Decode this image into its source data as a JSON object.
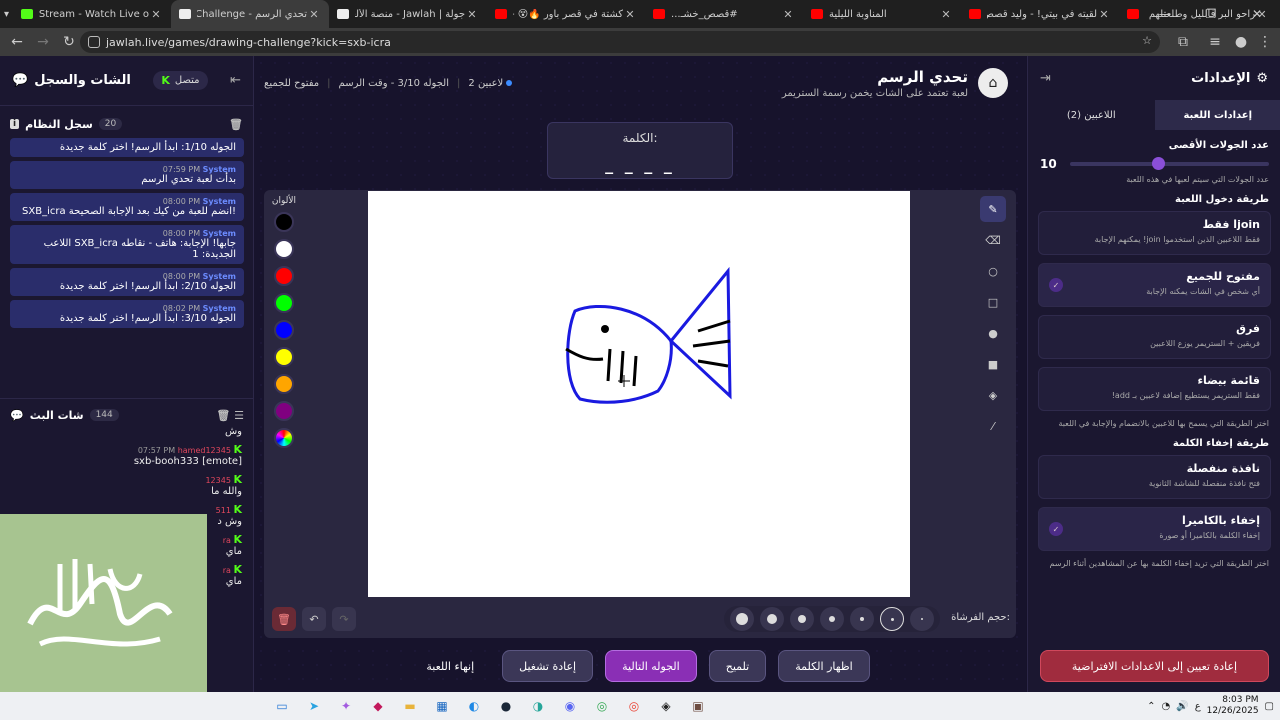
{
  "browser": {
    "tabs": [
      {
        "title": "SXB_icra Stream - Watch Live o",
        "color": "#53fc18",
        "active": false
      },
      {
        "title": "تحدي الرسم - Drawing Challenge",
        "color": "#eeeeee",
        "active": true
      },
      {
        "title": "جولة | Jawlah - منصة الألعاب الت",
        "color": "#eeeeee",
        "active": false
      },
      {
        "title": "كشتة في قصر باور 🔥😵 - Tube",
        "color": "#ff0000",
        "active": false
      },
      {
        "title": "#قصص_خشـ...",
        "color": "#ff0000",
        "active": false
      },
      {
        "title": "المناوبة الليلية",
        "color": "#ff0000",
        "active": false
      },
      {
        "title": "لقيته في بيتي! - وليد قصص - e",
        "color": "#ff0000",
        "active": false
      },
      {
        "title": "راحو البر فالليل وطلعتلهم ام دنوه",
        "color": "#ff0000",
        "active": false
      }
    ],
    "url": "jawlah.live/games/drawing-challenge?kick=sxb-icra"
  },
  "left": {
    "title": "الشات والسجل",
    "status": "متصل",
    "sys_title": "سجل النظام",
    "sys_count": "20",
    "sys_msgs": [
      {
        "author": "",
        "time": "",
        "text": "الجوله 1/10: ابدأ الرسم! اختر كلمة جديدة"
      },
      {
        "author": "System",
        "time": "07:59 PM",
        "text": "بدأت لعبة تحدي الرسم"
      },
      {
        "author": "System",
        "time": "08:00 PM",
        "text": "SXB_icra انضم للعبة من كيك بعد الإجابة الصحيحة!"
      },
      {
        "author": "System",
        "time": "08:00 PM",
        "text": "اللاعب SXB_icra جابها! الإجابة: هاتف - نقاطه الجديدة: 1"
      },
      {
        "author": "System",
        "time": "08:00 PM",
        "text": "الجوله 2/10: ابدأ الرسم! اختر كلمة جديدة"
      },
      {
        "author": "System",
        "time": "08:02 PM",
        "text": "الجوله 3/10: ابدأ الرسم! اختر كلمة جديدة"
      }
    ],
    "chat_title": "شات البث",
    "chat_count": "144",
    "chat_msgs": [
      {
        "user": "",
        "time": "",
        "text": "وش"
      },
      {
        "user": "hamed12345",
        "time": "07:57 PM",
        "text": "sxb-booh333 [emote]"
      },
      {
        "user": "12345",
        "time": "",
        "text": "والله ما"
      },
      {
        "user": "511",
        "time": "",
        "text": "وش د"
      },
      {
        "user": "ra",
        "time": "",
        "text": "ماي"
      },
      {
        "user": "ra",
        "time": "",
        "text": "ماي"
      }
    ]
  },
  "game": {
    "title": "تحدي الرسم",
    "subtitle": "لعبة تعتمد على الشات يخمن رسمة الستريمر",
    "players": "2 لاعبين",
    "round": "الجوله 3/10 - وقت الرسم",
    "mode": "مفتوح للجميع",
    "word_label": "الكلمة:",
    "word_blanks": "_ _ _ _",
    "colors_label": "الألوان",
    "colors": [
      "#000000",
      "#ffffff",
      "#ff0000",
      "#00ff00",
      "#0000ff",
      "#ffff00",
      "#ffa500",
      "#800080"
    ],
    "brush_label": "حجم الفرشاة:",
    "buttons": {
      "show_word": "اظهار الكلمة",
      "hint": "تلميح",
      "next": "الجوله التالية",
      "restart": "إعادة تشغيل",
      "end": "إنهاء اللعبة"
    }
  },
  "settings": {
    "title": "الإعدادات",
    "tab_players": "اللاعبين (2)",
    "tab_game": "إعدادات اللعبة",
    "max_rounds_label": "عدد الجولات الأقصى",
    "max_rounds_value": "10",
    "max_rounds_note": "عدد الجولات التي سيتم لعبها في هذه اللعبة",
    "entry_label": "طريقة دخول اللعبة",
    "entry_options": [
      {
        "title": "joinا فقط",
        "desc": "فقط اللاعبين الذين استخدموا join! يمكنهم الإجابة",
        "selected": false
      },
      {
        "title": "مفتوح للجميع",
        "desc": "أي شخص في الشات يمكنه الإجابة",
        "selected": true
      },
      {
        "title": "فرق",
        "desc": "فريقين + الستريمر يوزع اللاعبين",
        "selected": false
      },
      {
        "title": "قائمة بيضاء",
        "desc": "فقط الستريمر يستطيع إضافة لاعبين بـ add!",
        "selected": false
      }
    ],
    "entry_note": "اختر الطريقة التي يسمح بها للاعبين بالانضمام والإجابة في اللعبة",
    "hide_label": "طريقة إخفاء الكلمة",
    "hide_options": [
      {
        "title": "نافذة منفصلة",
        "desc": "فتح نافذة منفصلة للشاشة الثانوية",
        "selected": false
      },
      {
        "title": "إخفاء بالكاميرا",
        "desc": "إخفاء الكلمة بالكاميرا أو صورة",
        "selected": true
      }
    ],
    "hide_note": "اختر الطريقة التي تريد إخفاء الكلمة بها عن المشاهدين أثناء الرسم",
    "reset": "إعادة تعيين إلى الاعدادات الافتراضية"
  },
  "taskbar": {
    "time": "8:03 PM",
    "date": "12/26/2025",
    "lang": "ع"
  }
}
